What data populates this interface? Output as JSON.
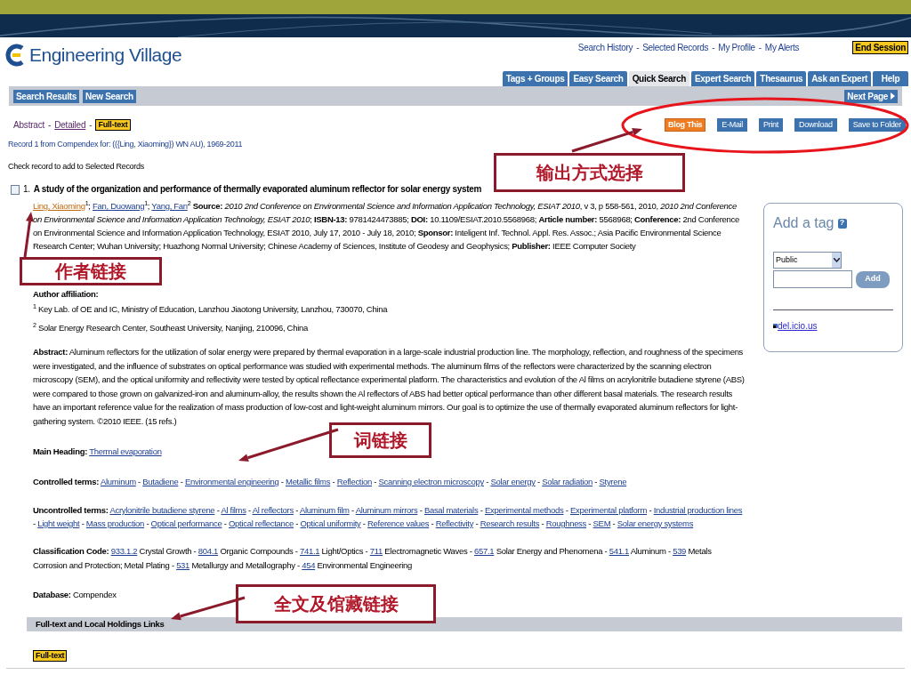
{
  "header": {
    "logo_text": "Engineering Village",
    "top_links": [
      "Search History",
      "Selected Records",
      "My Profile",
      "My Alerts"
    ],
    "top_separator": "-",
    "end_session": "End Session",
    "tabs": [
      {
        "label": "Tags + Groups",
        "selected": false
      },
      {
        "label": "Easy Search",
        "selected": false
      },
      {
        "label": "Quick Search",
        "selected": true
      },
      {
        "label": "Expert Search",
        "selected": false
      },
      {
        "label": "Thesaurus",
        "selected": false
      },
      {
        "label": "Ask an Expert",
        "selected": false
      },
      {
        "label": "Help",
        "selected": false
      }
    ]
  },
  "nav_bar": {
    "buttons": [
      "Search Results",
      "New Search"
    ],
    "next_page": "Next Page"
  },
  "view_links": [
    {
      "label": "Abstract",
      "kind": "current"
    },
    {
      "label": "Detailed",
      "kind": "link"
    },
    {
      "label": "Full-text",
      "kind": "badge"
    }
  ],
  "view_separator": "-",
  "output_buttons": [
    {
      "label": "Blog This",
      "kind": "featured"
    },
    {
      "label": "E-Mail",
      "kind": "plain"
    },
    {
      "label": "Print",
      "kind": "plain"
    },
    {
      "label": "Download",
      "kind": "plain"
    },
    {
      "label": "Save to Folder",
      "kind": "plain"
    }
  ],
  "record_info": "Record 1 from Compendex for: (({Ling, Xiaoming}) WN AU), 1969-2011",
  "check_hint": "Check record to add to Selected Records",
  "record": {
    "checked": false,
    "number": "1.",
    "title": "A study of the organization and performance of thermally evaporated aluminum reflector for solar energy system",
    "authors": [
      {
        "name": "Ling, Xiaoming",
        "sup": "1",
        "suffix": ";",
        "highlighted": true
      },
      {
        "name": "Fan, Duowang",
        "sup": "1",
        "suffix": ";",
        "highlighted": false
      },
      {
        "name": "Yang, Fan",
        "sup": "2",
        "highlighted": false
      }
    ],
    "details": "**Source:** *2010 2nd Conference on Environmental Science and Information Application Technology, ESIAT 2010*, v 3, p 558-561, 2010, *2010 2nd Conference on Environmental Science and Information Application Technology, ESIAT 2010*; **ISBN-13:** 9781424473885; **DOI:** 10.1109/ESIAT.2010.5568968; **Article number:** 5568968; **Conference:** 2nd Conference on Environmental Science and Information Application Technology, ESIAT 2010, July 17, 2010 - July 18, 2010; **Sponsor:** Inteligent Inf. Technol. Appl. Res. Assoc.; Asia Pacific Environmental Science Research Center; Wuhan University; Huazhong Normal University; Chinese Academy of Sciences, Institute of Geodesy and Geophysics; **Publisher:** IEEE Computer Society"
  },
  "affiliation": {
    "label": "Author affiliation:",
    "lines": [
      {
        "sup": "1",
        "text": "Key Lab. of OE and IC, Ministry of Education, Lanzhou Jiaotong University, Lanzhou, 730070, China"
      },
      {
        "sup": "2",
        "text": "Solar Energy Research Center, Southeast University, Nanjing, 210096, China"
      }
    ]
  },
  "abstract": {
    "label": "Abstract:",
    "text": "Aluminum reflectors for the utilization of solar energy were prepared by thermal evaporation in a large-scale industrial production line. The morphology, reflection, and roughness of the specimens were investigated, and the influence of substrates on optical performance was studied with experimental methods. The aluminum films of the reflectors were characterized by the scanning electron microscopy (SEM), and the optical uniformity and reflectivity were tested by optical reflectance experimental platform. The characteristics and evolution of the Al films on acrylonitrile butadiene styrene (ABS) were compared to those grown on galvanized-iron and aluminum-alloy, the results shown the Al reflectors of ABS had better optical performance than other different basal materials. The research results have an important reference value for the realization of mass production of low-cost and light-weight aluminum mirrors. Our goal is to optimize the use of thermally evaporated aluminum reflectors for light-gathering system. ©2010 IEEE. (15 refs.)"
  },
  "main_heading": {
    "label": "Main Heading:",
    "terms": [
      "Thermal evaporation"
    ]
  },
  "controlled_terms": {
    "label": "Controlled terms:",
    "separator": "-",
    "terms": [
      "Aluminum",
      "Butadiene",
      "Environmental engineering",
      "Metallic films",
      "Reflection",
      "Scanning electron microscopy",
      "Solar energy",
      "Solar radiation",
      "Styrene"
    ]
  },
  "uncontrolled_terms": {
    "label": "Uncontrolled terms:",
    "separator": "-",
    "terms": [
      "Acrylonitrile butadiene styrene",
      "Al films",
      "Al reflectors",
      "Aluminum film",
      "Aluminum mirrors",
      "Basal materials",
      "Experimental methods",
      "Experimental platform",
      "Industrial production lines",
      "Light weight",
      "Mass production",
      "Optical performance",
      "Optical reflectance",
      "Optical uniformity",
      "Reference values",
      "Reflectivity",
      "Research results",
      "Roughness",
      "SEM",
      "Solar energy systems"
    ]
  },
  "classification": {
    "label": "Classification Code:",
    "separator": "-",
    "codes": [
      {
        "code": "933.1.2",
        "text": "Crystal Growth"
      },
      {
        "code": "804.1",
        "text": "Organic Compounds"
      },
      {
        "code": "741.1",
        "text": "Light/Optics"
      },
      {
        "code": "711",
        "text": "Electromagnetic Waves"
      },
      {
        "code": "657.1",
        "text": "Solar Energy and Phenomena"
      },
      {
        "code": "541.1",
        "text": "Aluminum"
      },
      {
        "code": "539",
        "text": "Metals Corrosion and Protection; Metal Plating"
      },
      {
        "code": "531",
        "text": "Metallurgy and Metallography"
      },
      {
        "code": "454",
        "text": "Environmental Engineering"
      }
    ]
  },
  "database": {
    "label": "Database:",
    "value": "Compendex"
  },
  "holdings": {
    "title": "Full-text and Local Holdings Links",
    "button": "Full-text"
  },
  "tag_box": {
    "title": "Add a tag",
    "help": "?",
    "visibility": "Public",
    "add": "Add",
    "link": "del.icio.us"
  },
  "annotations": [
    {
      "text": "输出方式选择"
    },
    {
      "text": "作者链接"
    },
    {
      "text": "词链接"
    },
    {
      "text": "全文及馆藏链接"
    }
  ]
}
